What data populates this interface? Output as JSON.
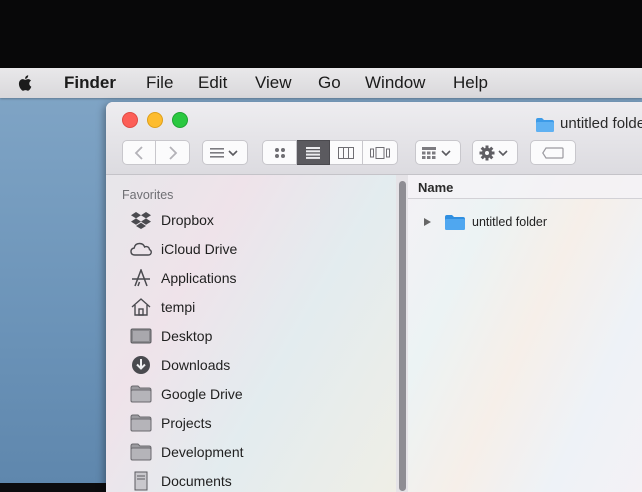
{
  "menubar": {
    "app_name": "Finder",
    "items": [
      "File",
      "Edit",
      "View",
      "Go",
      "Window",
      "Help"
    ]
  },
  "window": {
    "title": "untitled folder",
    "toolbar": {
      "view_modes": [
        "icon-view",
        "list-view",
        "column-view",
        "cover-flow-view"
      ],
      "active_view": "list-view"
    }
  },
  "sidebar": {
    "section_title": "Favorites",
    "items": [
      {
        "label": "Dropbox",
        "icon": "dropbox-icon"
      },
      {
        "label": "iCloud Drive",
        "icon": "cloud-icon"
      },
      {
        "label": "Applications",
        "icon": "applications-icon"
      },
      {
        "label": "tempi",
        "icon": "home-icon"
      },
      {
        "label": "Desktop",
        "icon": "desktop-icon"
      },
      {
        "label": "Downloads",
        "icon": "downloads-icon"
      },
      {
        "label": "Google Drive",
        "icon": "folder-icon"
      },
      {
        "label": "Projects",
        "icon": "folder-icon"
      },
      {
        "label": "Development",
        "icon": "folder-icon"
      },
      {
        "label": "Documents",
        "icon": "documents-icon"
      }
    ]
  },
  "main": {
    "column_header": "Name",
    "rows": [
      {
        "name": "untitled folder"
      }
    ]
  },
  "colors": {
    "folder_blue": "#3d9be8",
    "close": "#fc5e57",
    "minimize": "#fdbc2e",
    "zoom": "#2ac840"
  }
}
